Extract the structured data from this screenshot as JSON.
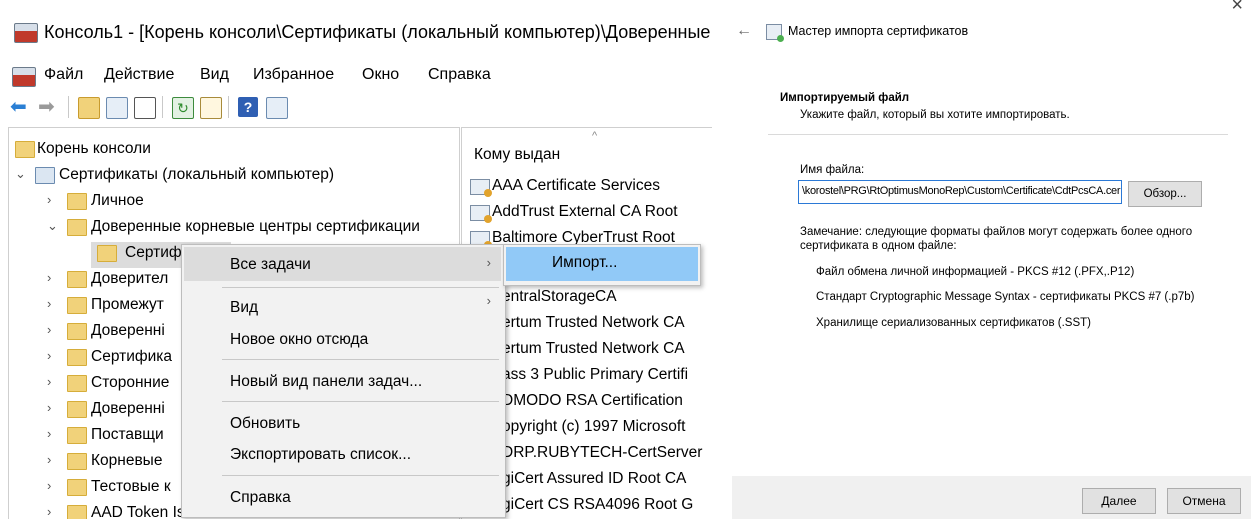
{
  "mmc": {
    "title": "Консоль1 - [Корень консоли\\Сертификаты (локальный компьютер)\\Доверенные",
    "menu": [
      "Файл",
      "Действие",
      "Вид",
      "Избранное",
      "Окно",
      "Справка"
    ],
    "toolbar_icons": [
      "back-icon",
      "forward-icon",
      "up-folder-icon",
      "show-hide-tree-icon",
      "properties-icon",
      "refresh-icon",
      "export-list-icon",
      "help-icon",
      "show-hide-action-pane-icon"
    ],
    "tree": {
      "root": "Корень консоли",
      "certs_local": "Сертификаты (локальный компьютер)",
      "personal": "Личное",
      "trusted_root": "Доверенные корневые центры сертификации",
      "certificates_selected": "Сертиф",
      "items": [
        "Доверител",
        "Промежут",
        "Доверенні",
        "Сертифика",
        "Сторонние",
        "Доверенні",
        "Поставщи",
        "Корневые",
        "Тестовые к",
        "AAD Token Issuer"
      ]
    },
    "list": {
      "header": "Кому выдан",
      "rows": [
        "AAA Certificate Services",
        "AddTrust External CA Root",
        "Baltimore CyberTrust Root",
        "entralStorageCA",
        "ertum Trusted Network CA",
        "ertum Trusted Network CA",
        "ass 3 Public Primary Certifi",
        "DMODO RSA Certification",
        "opyright (c) 1997 Microsoft",
        "DRP.RUBYTECH-CertServer",
        "giCert Assured ID Root CA",
        "giCert CS RSA4096 Root G"
      ]
    },
    "context_menu": {
      "all_tasks": "Все задачи",
      "view": "Вид",
      "new_window": "Новое окно отсюда",
      "new_taskpad": "Новый вид панели задач...",
      "refresh": "Обновить",
      "export_list": "Экспортировать список...",
      "help": "Справка"
    },
    "submenu": {
      "import": "Импорт..."
    }
  },
  "wizard": {
    "title": "Мастер импорта сертификатов",
    "section_title": "Импортируемый файл",
    "section_subtitle": "Укажите файл, который вы хотите импортировать.",
    "file_label": "Имя файла:",
    "file_value": "\\korostel\\PRG\\RtOptimusMonoRep\\Custom\\Certificate\\CdtPcsCA.cer",
    "browse": "Обзор...",
    "note": "Замечание: следующие форматы файлов могут содержать более одного сертификата в одном файле:",
    "formats": [
      "Файл обмена личной информацией - PKCS #12 (.PFX,.P12)",
      "Стандарт Cryptographic Message Syntax - сертификаты PKCS #7 (.p7b)",
      "Хранилище сериализованных сертификатов (.SST)"
    ],
    "next": "Далее",
    "cancel": "Отмена"
  },
  "colors": {
    "submenu_highlight": "#91c9f7",
    "input_border": "#2b79d6"
  }
}
